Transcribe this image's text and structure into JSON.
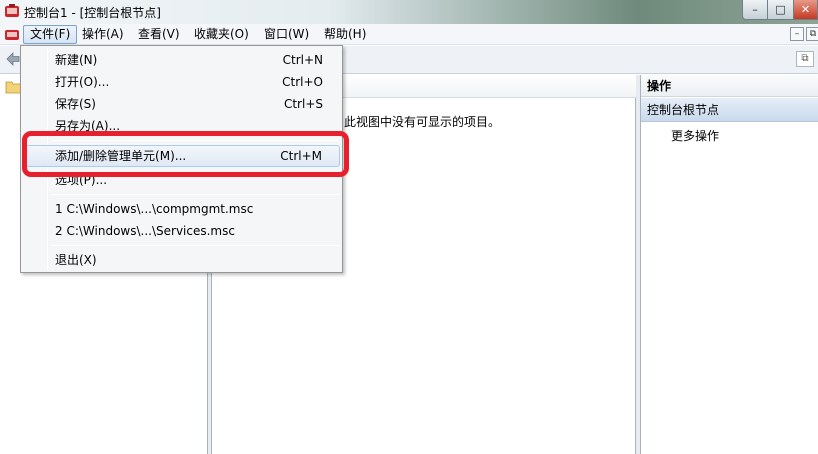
{
  "window": {
    "title": "控制台1 - [控制台根节点]",
    "controls": {
      "minimize": "–",
      "maximize": "□",
      "close": "✕"
    }
  },
  "menubar": {
    "items": [
      {
        "label": "文件(F)",
        "active": true
      },
      {
        "label": "操作(A)"
      },
      {
        "label": "查看(V)"
      },
      {
        "label": "收藏夹(O)"
      },
      {
        "label": "窗口(W)"
      },
      {
        "label": "帮助(H)"
      }
    ],
    "mdi": {
      "minimize": "–",
      "restore": "⧉"
    }
  },
  "file_menu": {
    "items": [
      {
        "label": "新建(N)",
        "shortcut": "Ctrl+N"
      },
      {
        "label": "打开(O)...",
        "shortcut": "Ctrl+O"
      },
      {
        "label": "保存(S)",
        "shortcut": "Ctrl+S"
      },
      {
        "label": "另存为(A)...",
        "shortcut": ""
      },
      {
        "label": "添加/删除管理单元(M)...",
        "shortcut": "Ctrl+M",
        "highlighted": true
      },
      {
        "label": "选项(P)...",
        "shortcut": ""
      },
      {
        "label": "1 C:\\Windows\\...\\compmgmt.msc",
        "shortcut": ""
      },
      {
        "label": "2 C:\\Windows\\...\\Services.msc",
        "shortcut": ""
      },
      {
        "label": "退出(X)",
        "shortcut": ""
      }
    ]
  },
  "center_pane": {
    "empty_message": "此视图中没有可显示的项目。"
  },
  "actions_pane": {
    "header": "操作",
    "group": "控制台根节点",
    "more": "更多操作"
  },
  "colors": {
    "highlight_border": "#e8202e",
    "menu_hover": "#dfe9f5",
    "pane_border": "#a9b3bd"
  }
}
